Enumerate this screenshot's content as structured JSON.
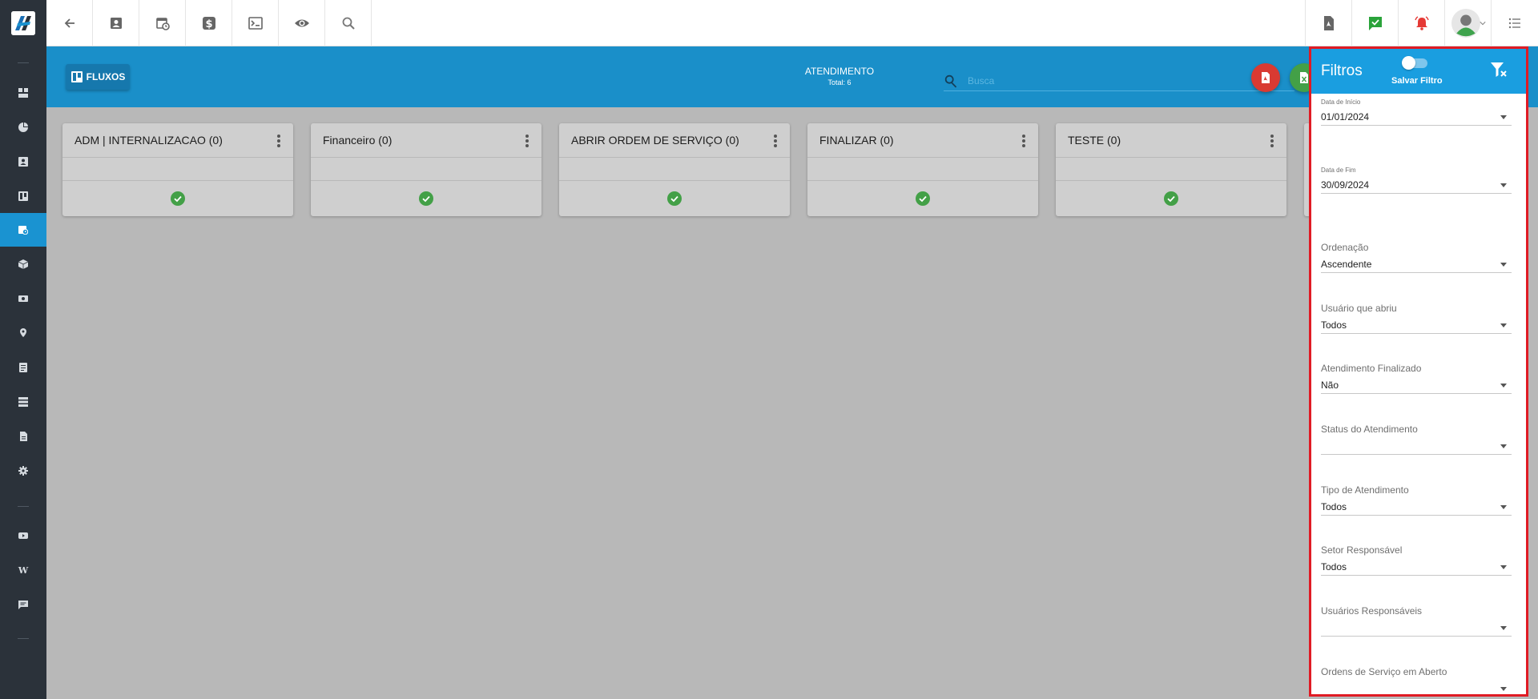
{
  "sidebar": {
    "items": [
      {
        "icon": "dashboard-icon"
      },
      {
        "icon": "pie-chart-icon"
      },
      {
        "icon": "contact-card-icon"
      },
      {
        "icon": "kanban-icon"
      },
      {
        "icon": "calendar-clock-icon",
        "active": true
      },
      {
        "icon": "cube-icon"
      },
      {
        "icon": "money-icon"
      },
      {
        "icon": "map-pin-icon"
      },
      {
        "icon": "list-icon"
      },
      {
        "icon": "server-icon"
      },
      {
        "icon": "document-icon"
      },
      {
        "icon": "gear-icon"
      },
      {
        "icon": "video-icon"
      },
      {
        "icon": "wiki-icon",
        "text": "W"
      },
      {
        "icon": "chat-icon"
      }
    ]
  },
  "topbar": {
    "left_buttons": [
      "back-arrow-icon",
      "contact-card-icon",
      "calendar-clock-icon",
      "dollar-icon",
      "terminal-icon",
      "eye-icon",
      "search-icon"
    ],
    "right_buttons": [
      "pdf-file-icon",
      "chat-check-icon",
      "alarm-bell-icon",
      "user-avatar-icon",
      "menu-list-icon"
    ]
  },
  "header": {
    "fluxos_label": "FLUXOS",
    "title": "ATENDIMENTO",
    "total": "Total: 6",
    "search_placeholder": "Busca"
  },
  "columns": [
    {
      "title": "ADM | INTERNALIZACAO (0)"
    },
    {
      "title": "Financeiro (0)"
    },
    {
      "title": "ABRIR ORDEM DE SERVIÇO (0)"
    },
    {
      "title": "FINALIZAR (0)"
    },
    {
      "title": "TESTE (0)"
    }
  ],
  "filters": {
    "title": "Filtros",
    "save_label": "Salvar Filtro",
    "fields": [
      {
        "label": "Data de Início",
        "value": "01/01/2024"
      },
      {
        "label": "Data de Fim",
        "value": "30/09/2024"
      },
      {
        "label": "Ordenação",
        "value": "Ascendente"
      },
      {
        "label": "Usuário que abriu",
        "value": "Todos"
      },
      {
        "label": "Atendimento Finalizado",
        "value": "Não"
      },
      {
        "label": "Status do Atendimento",
        "value": ""
      },
      {
        "label": "Tipo de Atendimento",
        "value": "Todos"
      },
      {
        "label": "Setor Responsável",
        "value": "Todos"
      },
      {
        "label": "Usuários Responsáveis",
        "value": ""
      },
      {
        "label": "Ordens de Serviço em Aberto",
        "value": ""
      }
    ]
  },
  "colors": {
    "sidebar": "#2b323a",
    "accent": "#1a8fc9",
    "panel_header": "#1a9ee0",
    "highlight_border": "#e01b24",
    "success": "#43a047"
  }
}
